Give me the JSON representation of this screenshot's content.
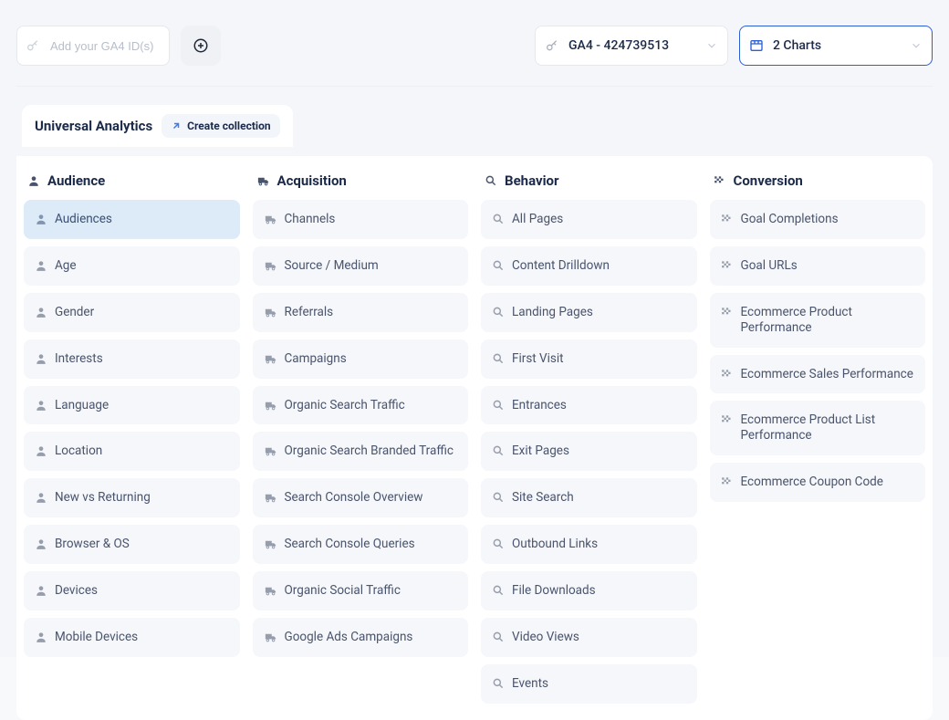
{
  "topbar": {
    "ga4_placeholder": "Add your GA4 ID(s)",
    "ga4_selected": "GA4 - 424739513",
    "charts_label": "2 Charts"
  },
  "tabs": {
    "title": "Universal Analytics",
    "create": "Create collection"
  },
  "cols": [
    {
      "icon": "person",
      "title": "Audience",
      "items": [
        {
          "label": "Audiences",
          "selected": true
        },
        {
          "label": "Age"
        },
        {
          "label": "Gender"
        },
        {
          "label": "Interests"
        },
        {
          "label": "Language"
        },
        {
          "label": "Location"
        },
        {
          "label": "New vs Returning"
        },
        {
          "label": "Browser & OS"
        },
        {
          "label": "Devices"
        },
        {
          "label": "Mobile Devices"
        }
      ]
    },
    {
      "icon": "truck",
      "title": "Acquisition",
      "items": [
        {
          "label": "Channels"
        },
        {
          "label": "Source / Medium"
        },
        {
          "label": "Referrals"
        },
        {
          "label": "Campaigns"
        },
        {
          "label": "Organic Search Traffic"
        },
        {
          "label": "Organic Search Branded Traffic"
        },
        {
          "label": "Search Console Overview"
        },
        {
          "label": "Search Console Queries"
        },
        {
          "label": "Organic Social Traffic"
        },
        {
          "label": "Google Ads Campaigns"
        }
      ]
    },
    {
      "icon": "search",
      "title": "Behavior",
      "items": [
        {
          "label": "All Pages"
        },
        {
          "label": "Content Drilldown"
        },
        {
          "label": "Landing Pages"
        },
        {
          "label": "First Visit"
        },
        {
          "label": "Entrances"
        },
        {
          "label": "Exit Pages"
        },
        {
          "label": "Site Search"
        },
        {
          "label": "Outbound Links"
        },
        {
          "label": "File Downloads"
        },
        {
          "label": "Video Views"
        },
        {
          "label": "Events"
        }
      ]
    },
    {
      "icon": "flag",
      "title": "Conversion",
      "items": [
        {
          "label": "Goal Completions"
        },
        {
          "label": "Goal URLs"
        },
        {
          "label": "Ecommerce Product Performance"
        },
        {
          "label": "Ecommerce Sales Performance"
        },
        {
          "label": "Ecommerce Product List Performance"
        },
        {
          "label": "Ecommerce Coupon Code"
        }
      ]
    }
  ]
}
